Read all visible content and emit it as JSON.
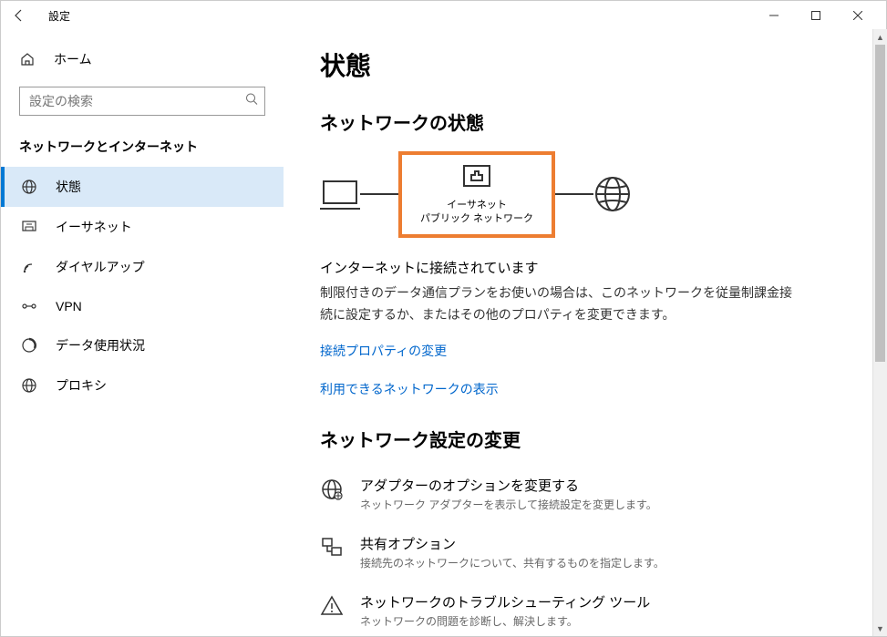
{
  "titlebar": {
    "title": "設定"
  },
  "sidebar": {
    "home": "ホーム",
    "search_placeholder": "設定の検索",
    "section": "ネットワークとインターネット",
    "items": [
      {
        "label": "状態"
      },
      {
        "label": "イーサネット"
      },
      {
        "label": "ダイヤルアップ"
      },
      {
        "label": "VPN"
      },
      {
        "label": "データ使用状況"
      },
      {
        "label": "プロキシ"
      }
    ]
  },
  "main": {
    "title": "状態",
    "network_status_header": "ネットワークの状態",
    "diagram": {
      "connection_name": "イーサネット",
      "network_type": "パブリック ネットワーク"
    },
    "connected_title": "インターネットに接続されています",
    "connected_desc": "制限付きのデータ通信プランをお使いの場合は、このネットワークを従量制課金接続に設定するか、またはその他のプロパティを変更できます。",
    "link_change_props": "接続プロパティの変更",
    "link_available": "利用できるネットワークの表示",
    "change_settings_header": "ネットワーク設定の変更",
    "settings": [
      {
        "label": "アダプターのオプションを変更する",
        "desc": "ネットワーク アダプターを表示して接続設定を変更します。"
      },
      {
        "label": "共有オプション",
        "desc": "接続先のネットワークについて、共有するものを指定します。"
      },
      {
        "label": "ネットワークのトラブルシューティング ツール",
        "desc": "ネットワークの問題を診断し、解決します。"
      }
    ]
  }
}
